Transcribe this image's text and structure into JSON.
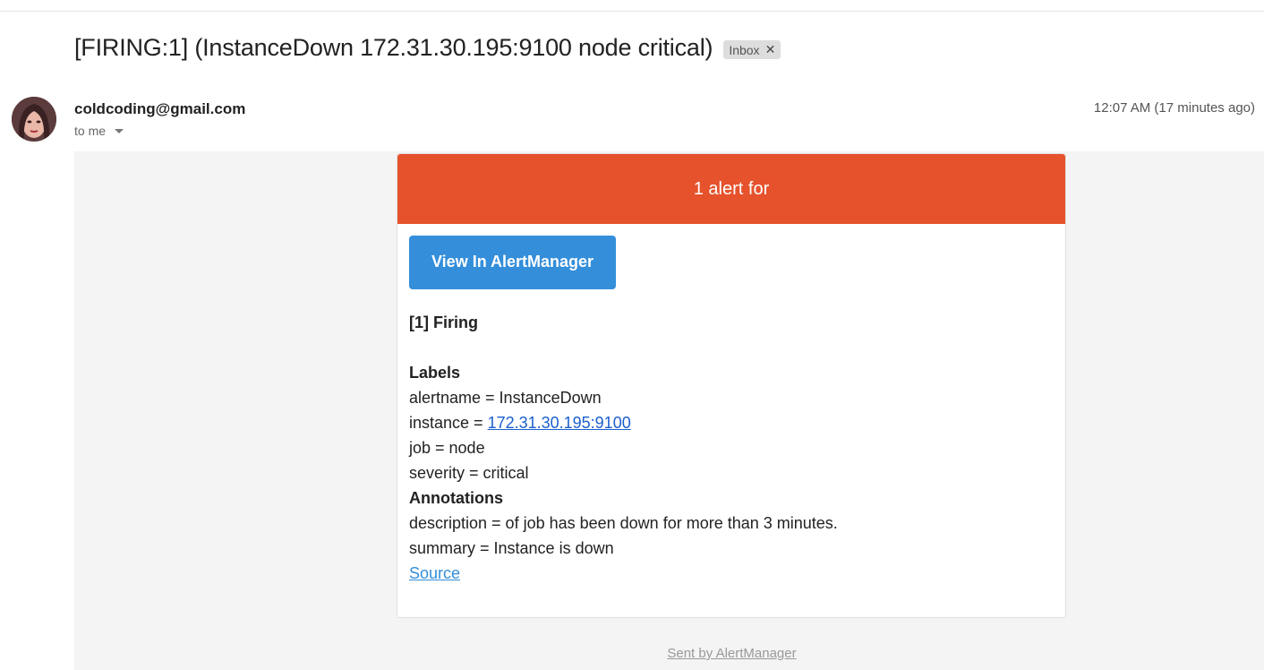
{
  "email": {
    "subject": "[FIRING:1] (InstanceDown 172.31.30.195:9100 node critical)",
    "label": "Inbox",
    "sender": "coldcoding@gmail.com",
    "recipient": "to me",
    "time": "12:07 AM (17 minutes ago)"
  },
  "alert": {
    "header": "1 alert for",
    "button_label": "View In AlertManager",
    "firing_title": "[1] Firing",
    "labels_title": "Labels",
    "alertname": "alertname = InstanceDown",
    "instance_prefix": "instance = ",
    "instance_link": "172.31.30.195:9100",
    "job": "job = node",
    "severity": "severity = critical",
    "annotations_title": "Annotations",
    "description": "description = of job has been down for more than 3 minutes.",
    "summary": "summary = Instance is down",
    "source_link": "Source"
  },
  "footer": {
    "text": "Sent by AlertManager"
  },
  "colors": {
    "header_bg": "#e6522c",
    "button_bg": "#348eda"
  },
  "icons": {
    "chip_close": "close-icon",
    "recipient_dropdown": "chevron-down-icon"
  }
}
